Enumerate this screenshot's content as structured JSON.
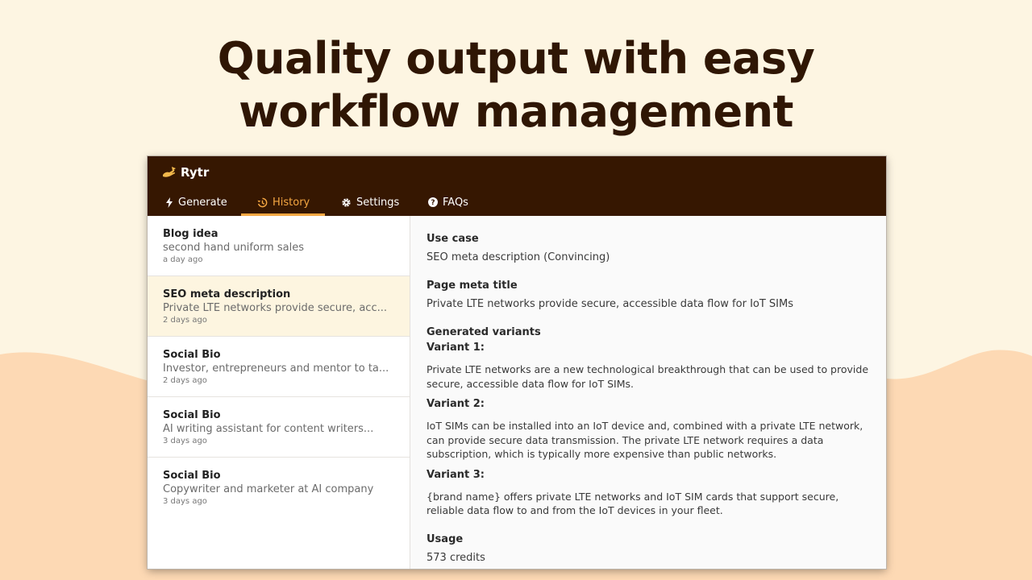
{
  "headline": {
    "line1": "Quality output with easy",
    "line2": "workflow management"
  },
  "app": {
    "name": "Rytr",
    "logo_icon": "hand-writing-icon",
    "colors": {
      "topbar": "#361701",
      "accent": "#f5a742",
      "active_item_bg": "#fdf5e0",
      "page_bg": "#fdf5e2",
      "wave": "#fdd9b4"
    }
  },
  "tabs": [
    {
      "label": "Generate",
      "icon": "bolt-icon",
      "active": false
    },
    {
      "label": "History",
      "icon": "history-icon",
      "active": true
    },
    {
      "label": "Settings",
      "icon": "gear-icon",
      "active": false
    },
    {
      "label": "FAQs",
      "icon": "question-icon",
      "active": false
    }
  ],
  "history": [
    {
      "title": "Blog idea",
      "subtitle": "second hand uniform sales",
      "time": "a day ago",
      "active": false
    },
    {
      "title": "SEO meta description",
      "subtitle": "Private LTE networks provide secure, acc...",
      "time": "2 days ago",
      "active": true
    },
    {
      "title": "Social Bio",
      "subtitle": "Investor, entrepreneurs and mentor to ta...",
      "time": "2 days ago",
      "active": false
    },
    {
      "title": "Social Bio",
      "subtitle": "AI writing assistant for content writers...",
      "time": "3 days ago",
      "active": false
    },
    {
      "title": "Social Bio",
      "subtitle": "Copywriter and marketer at AI company",
      "time": "3 days ago",
      "active": false
    }
  ],
  "detail": {
    "use_case_label": "Use case",
    "use_case_value": "SEO meta description (Convincing)",
    "meta_title_label": "Page meta title",
    "meta_title_value": "Private LTE networks provide secure, accessible data flow for IoT SIMs",
    "variants_label": "Generated variants",
    "variants": [
      {
        "label": "Variant 1:",
        "text": "Private LTE networks are a new technological breakthrough that can be used to provide secure, accessible data flow for IoT SIMs."
      },
      {
        "label": "Variant 2:",
        "text": "IoT SIMs can be installed into an IoT device and, combined with a private LTE network, can provide secure data transmission. The private LTE network requires a data subscription, which is typically more expensive than public networks."
      },
      {
        "label": "Variant 3:",
        "text": "{brand name} offers private LTE networks and IoT SIM cards that support secure, reliable data flow to and from the IoT devices in your fleet."
      }
    ],
    "usage_label": "Usage",
    "usage_value": "573 credits"
  }
}
